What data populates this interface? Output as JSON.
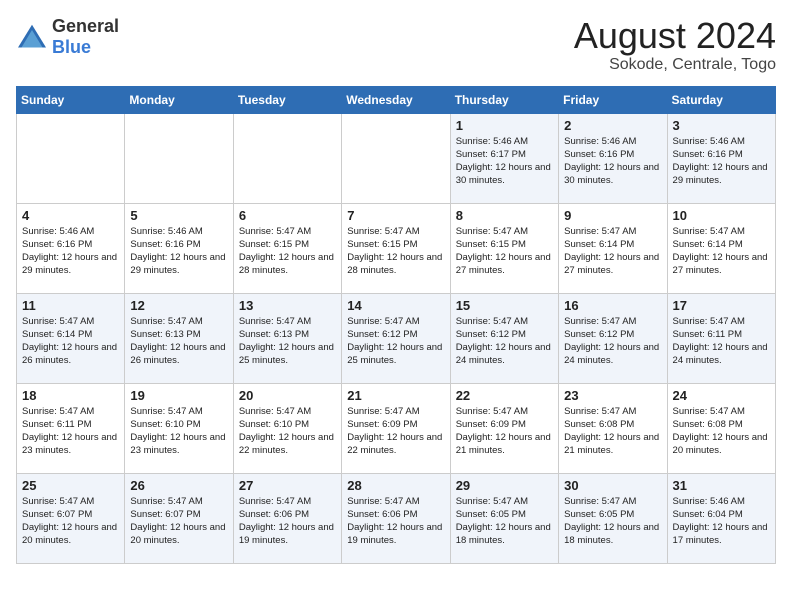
{
  "logo": {
    "general": "General",
    "blue": "Blue"
  },
  "title": "August 2024",
  "subtitle": "Sokode, Centrale, Togo",
  "weekdays": [
    "Sunday",
    "Monday",
    "Tuesday",
    "Wednesday",
    "Thursday",
    "Friday",
    "Saturday"
  ],
  "weeks": [
    [
      {
        "day": "",
        "sunrise": "",
        "sunset": "",
        "daylight": ""
      },
      {
        "day": "",
        "sunrise": "",
        "sunset": "",
        "daylight": ""
      },
      {
        "day": "",
        "sunrise": "",
        "sunset": "",
        "daylight": ""
      },
      {
        "day": "",
        "sunrise": "",
        "sunset": "",
        "daylight": ""
      },
      {
        "day": "1",
        "sunrise": "Sunrise: 5:46 AM",
        "sunset": "Sunset: 6:17 PM",
        "daylight": "Daylight: 12 hours and 30 minutes."
      },
      {
        "day": "2",
        "sunrise": "Sunrise: 5:46 AM",
        "sunset": "Sunset: 6:16 PM",
        "daylight": "Daylight: 12 hours and 30 minutes."
      },
      {
        "day": "3",
        "sunrise": "Sunrise: 5:46 AM",
        "sunset": "Sunset: 6:16 PM",
        "daylight": "Daylight: 12 hours and 29 minutes."
      }
    ],
    [
      {
        "day": "4",
        "sunrise": "Sunrise: 5:46 AM",
        "sunset": "Sunset: 6:16 PM",
        "daylight": "Daylight: 12 hours and 29 minutes."
      },
      {
        "day": "5",
        "sunrise": "Sunrise: 5:46 AM",
        "sunset": "Sunset: 6:16 PM",
        "daylight": "Daylight: 12 hours and 29 minutes."
      },
      {
        "day": "6",
        "sunrise": "Sunrise: 5:47 AM",
        "sunset": "Sunset: 6:15 PM",
        "daylight": "Daylight: 12 hours and 28 minutes."
      },
      {
        "day": "7",
        "sunrise": "Sunrise: 5:47 AM",
        "sunset": "Sunset: 6:15 PM",
        "daylight": "Daylight: 12 hours and 28 minutes."
      },
      {
        "day": "8",
        "sunrise": "Sunrise: 5:47 AM",
        "sunset": "Sunset: 6:15 PM",
        "daylight": "Daylight: 12 hours and 27 minutes."
      },
      {
        "day": "9",
        "sunrise": "Sunrise: 5:47 AM",
        "sunset": "Sunset: 6:14 PM",
        "daylight": "Daylight: 12 hours and 27 minutes."
      },
      {
        "day": "10",
        "sunrise": "Sunrise: 5:47 AM",
        "sunset": "Sunset: 6:14 PM",
        "daylight": "Daylight: 12 hours and 27 minutes."
      }
    ],
    [
      {
        "day": "11",
        "sunrise": "Sunrise: 5:47 AM",
        "sunset": "Sunset: 6:14 PM",
        "daylight": "Daylight: 12 hours and 26 minutes."
      },
      {
        "day": "12",
        "sunrise": "Sunrise: 5:47 AM",
        "sunset": "Sunset: 6:13 PM",
        "daylight": "Daylight: 12 hours and 26 minutes."
      },
      {
        "day": "13",
        "sunrise": "Sunrise: 5:47 AM",
        "sunset": "Sunset: 6:13 PM",
        "daylight": "Daylight: 12 hours and 25 minutes."
      },
      {
        "day": "14",
        "sunrise": "Sunrise: 5:47 AM",
        "sunset": "Sunset: 6:12 PM",
        "daylight": "Daylight: 12 hours and 25 minutes."
      },
      {
        "day": "15",
        "sunrise": "Sunrise: 5:47 AM",
        "sunset": "Sunset: 6:12 PM",
        "daylight": "Daylight: 12 hours and 24 minutes."
      },
      {
        "day": "16",
        "sunrise": "Sunrise: 5:47 AM",
        "sunset": "Sunset: 6:12 PM",
        "daylight": "Daylight: 12 hours and 24 minutes."
      },
      {
        "day": "17",
        "sunrise": "Sunrise: 5:47 AM",
        "sunset": "Sunset: 6:11 PM",
        "daylight": "Daylight: 12 hours and 24 minutes."
      }
    ],
    [
      {
        "day": "18",
        "sunrise": "Sunrise: 5:47 AM",
        "sunset": "Sunset: 6:11 PM",
        "daylight": "Daylight: 12 hours and 23 minutes."
      },
      {
        "day": "19",
        "sunrise": "Sunrise: 5:47 AM",
        "sunset": "Sunset: 6:10 PM",
        "daylight": "Daylight: 12 hours and 23 minutes."
      },
      {
        "day": "20",
        "sunrise": "Sunrise: 5:47 AM",
        "sunset": "Sunset: 6:10 PM",
        "daylight": "Daylight: 12 hours and 22 minutes."
      },
      {
        "day": "21",
        "sunrise": "Sunrise: 5:47 AM",
        "sunset": "Sunset: 6:09 PM",
        "daylight": "Daylight: 12 hours and 22 minutes."
      },
      {
        "day": "22",
        "sunrise": "Sunrise: 5:47 AM",
        "sunset": "Sunset: 6:09 PM",
        "daylight": "Daylight: 12 hours and 21 minutes."
      },
      {
        "day": "23",
        "sunrise": "Sunrise: 5:47 AM",
        "sunset": "Sunset: 6:08 PM",
        "daylight": "Daylight: 12 hours and 21 minutes."
      },
      {
        "day": "24",
        "sunrise": "Sunrise: 5:47 AM",
        "sunset": "Sunset: 6:08 PM",
        "daylight": "Daylight: 12 hours and 20 minutes."
      }
    ],
    [
      {
        "day": "25",
        "sunrise": "Sunrise: 5:47 AM",
        "sunset": "Sunset: 6:07 PM",
        "daylight": "Daylight: 12 hours and 20 minutes."
      },
      {
        "day": "26",
        "sunrise": "Sunrise: 5:47 AM",
        "sunset": "Sunset: 6:07 PM",
        "daylight": "Daylight: 12 hours and 20 minutes."
      },
      {
        "day": "27",
        "sunrise": "Sunrise: 5:47 AM",
        "sunset": "Sunset: 6:06 PM",
        "daylight": "Daylight: 12 hours and 19 minutes."
      },
      {
        "day": "28",
        "sunrise": "Sunrise: 5:47 AM",
        "sunset": "Sunset: 6:06 PM",
        "daylight": "Daylight: 12 hours and 19 minutes."
      },
      {
        "day": "29",
        "sunrise": "Sunrise: 5:47 AM",
        "sunset": "Sunset: 6:05 PM",
        "daylight": "Daylight: 12 hours and 18 minutes."
      },
      {
        "day": "30",
        "sunrise": "Sunrise: 5:47 AM",
        "sunset": "Sunset: 6:05 PM",
        "daylight": "Daylight: 12 hours and 18 minutes."
      },
      {
        "day": "31",
        "sunrise": "Sunrise: 5:46 AM",
        "sunset": "Sunset: 6:04 PM",
        "daylight": "Daylight: 12 hours and 17 minutes."
      }
    ]
  ]
}
